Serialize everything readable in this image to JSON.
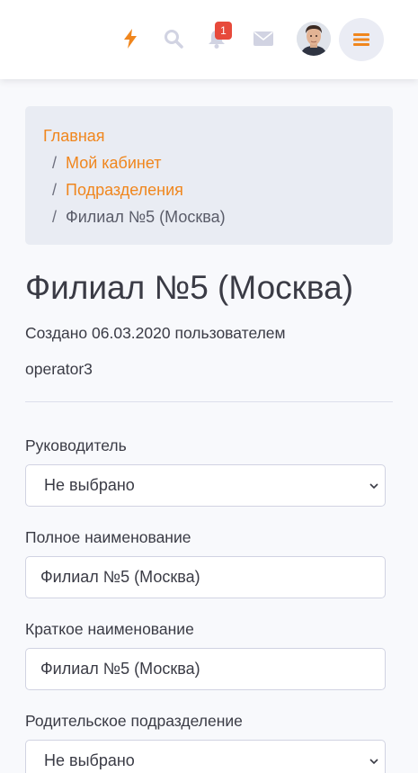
{
  "topbar": {
    "notifications_count": "1",
    "colors": {
      "accent": "#f0861d",
      "icon_muted": "#d1d3e2",
      "badge": "#e74a3b"
    },
    "icons": [
      "bolt-icon",
      "search-icon",
      "bell-icon",
      "envelope-icon",
      "menu-icon"
    ]
  },
  "breadcrumb": {
    "items": [
      "Главная",
      "Мой кабинет",
      "Подразделения"
    ],
    "separator": "/",
    "current": "Филиал №5 (Москва)"
  },
  "page": {
    "title": "Филиал №5 (Москва)",
    "meta_line1": "Создано 06.03.2020 пользователем",
    "meta_line2": "operator3"
  },
  "form": {
    "manager_label": "Руководитель",
    "manager_value": "Не выбрано",
    "full_name_label": "Полное наименование",
    "full_name_value": "Филиал №5 (Москва)",
    "short_name_label": "Краткое наименование",
    "short_name_value": "Филиал №5 (Москва)",
    "parent_label": "Родительское подразделение",
    "parent_value": "Не выбрано"
  }
}
